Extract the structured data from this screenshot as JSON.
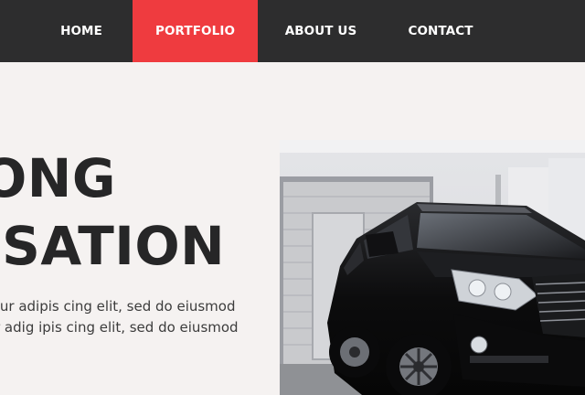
{
  "nav": {
    "items": [
      {
        "label": "HOME",
        "active": false
      },
      {
        "label": "PORTFOLIO",
        "active": true
      },
      {
        "label": "ABOUT US",
        "active": false
      },
      {
        "label": "CONTACT",
        "active": false
      }
    ]
  },
  "hero": {
    "title_line1": "ONG",
    "title_line2": "ISATION",
    "text_line1": "tur adipis cing elit, sed do eiusmod",
    "text_line2": "r adig ipis cing elit, sed do eiusmod",
    "image": "black-suv-in-garage-photo"
  },
  "colors": {
    "nav_bg": "#2d2d2e",
    "accent": "#ef3b3f",
    "page_bg": "#f5f2f1",
    "heading": "#262627"
  }
}
